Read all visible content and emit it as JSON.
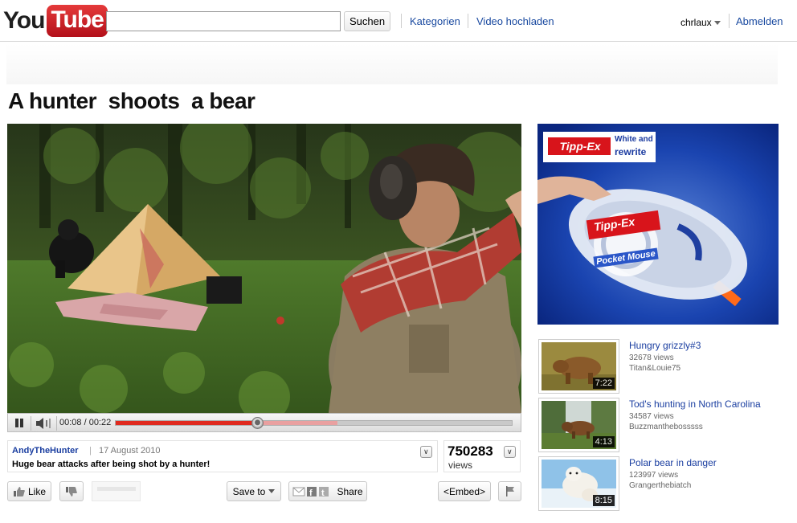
{
  "header": {
    "logo_you": "You",
    "logo_tube": "Tube",
    "search_placeholder": "",
    "search_button": "Suchen",
    "nav": [
      "Kategorien",
      "Video hochladen"
    ],
    "user": "chrlaux",
    "logout": "Abmelden"
  },
  "video": {
    "title": "A hunter  shoots  a bear",
    "time": "00:08 / 00:22",
    "progress_fraction": 0.36,
    "buffered_fraction": 0.56,
    "uploader": "AndyTheHunter",
    "separator": "|",
    "date": "17 August 2010",
    "description": "Huge bear attacks after being shot by a hunter!",
    "views_count": "750283",
    "views_label": "views"
  },
  "actions": {
    "like": "Like",
    "save_to": "Save to",
    "share": "Share",
    "embed": "<Embed>"
  },
  "ad": {
    "brand": "Tipp-Ex",
    "tagline_line1": "White and",
    "tagline_line2": "rewrite",
    "product_label": "Tipp-Ex",
    "product_name": "Pocket Mouse"
  },
  "related": [
    {
      "title": "Hungry grizzly#3",
      "views": "32678 views",
      "author": "Titan&Louie75",
      "duration": "7:22"
    },
    {
      "title": "Tod's hunting in North Carolina",
      "views": "34587 views",
      "author": "Buzzmanthebosssss",
      "duration": "4:13"
    },
    {
      "title": "Polar bear in danger",
      "views": "123997 views",
      "author": "Grangerthebiatch",
      "duration": "8:15"
    }
  ],
  "colors": {
    "link": "#1a4aa0",
    "progress_played": "#e02a1f",
    "brand_red": "#cc181e",
    "ad_blue": "#0d2f9a"
  }
}
